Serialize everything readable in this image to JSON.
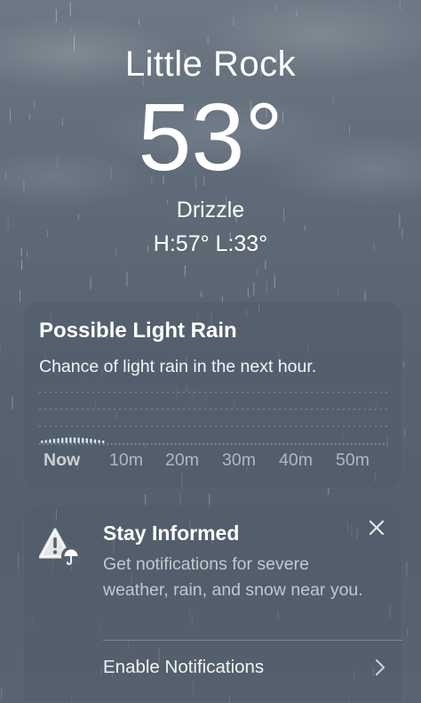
{
  "location": {
    "city": "Little Rock",
    "temperature": "53°",
    "condition": "Drizzle",
    "high_low": "H:57°  L:33°"
  },
  "rain_card": {
    "title": "Possible Light Rain",
    "subtitle": "Chance of light rain in the next hour.",
    "ticks": [
      "Now",
      "10m",
      "20m",
      "30m",
      "40m",
      "50m"
    ],
    "intensity_bars": 16
  },
  "notification_card": {
    "title": "Stay Informed",
    "body": "Get notifications for severe weather, rain, and snow near you.",
    "action_label": "Enable Notifications"
  },
  "icons": {
    "warning": "warning-umbrella-icon",
    "close": "close-icon",
    "chevron": "chevron-right-icon"
  },
  "colors": {
    "card_bg": "#505c6c",
    "precip_bars": "#cde6f4"
  }
}
